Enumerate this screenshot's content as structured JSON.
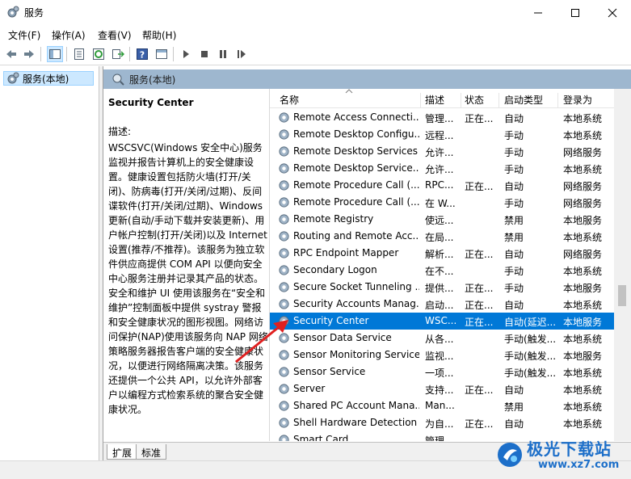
{
  "window": {
    "title": "服务"
  },
  "menu": [
    "文件(F)",
    "操作(A)",
    "查看(V)",
    "帮助(H)"
  ],
  "tree": {
    "root_label": "服务(本地)"
  },
  "panel": {
    "header": "服务(本地)"
  },
  "description": {
    "service_title": "Security Center",
    "label": "描述:",
    "text": "WSCSVC(Windows 安全中心)服务监视并报告计算机上的安全健康设置。健康设置包括防火墙(打开/关闭)、防病毒(打开/关闭/过期)、反间谍软件(打开/关闭/过期)、Windows 更新(自动/手动下载并安装更新)、用户帐户控制(打开/关闭)以及 Internet 设置(推荐/不推荐)。该服务为独立软件供应商提供 COM API 以便向安全中心服务注册并记录其产品的状态。安全和维护 UI 使用该服务在“安全和维护”控制面板中提供 systray 警报和安全健康状况的图形视图。网络访问保护(NAP)使用该服务向 NAP 网络策略服务器报告客户端的安全健康状况，以便进行网络隔离决策。该服务还提供一个公共 API，以允许外部客户以编程方式检索系统的聚合安全健康状况。"
  },
  "columns": {
    "name": "名称",
    "desc": "描述",
    "status": "状态",
    "startup": "启动类型",
    "logon": "登录为"
  },
  "rows": [
    {
      "name": "Remote Access Connecti...",
      "desc": "管理...",
      "status": "正在...",
      "startup": "自动",
      "logon": "本地系统"
    },
    {
      "name": "Remote Desktop Configu...",
      "desc": "远程...",
      "status": "",
      "startup": "手动",
      "logon": "本地系统"
    },
    {
      "name": "Remote Desktop Services",
      "desc": "允许...",
      "status": "",
      "startup": "手动",
      "logon": "网络服务"
    },
    {
      "name": "Remote Desktop Service...",
      "desc": "允许...",
      "status": "",
      "startup": "手动",
      "logon": "本地系统"
    },
    {
      "name": "Remote Procedure Call (...",
      "desc": "RPC...",
      "status": "正在...",
      "startup": "自动",
      "logon": "网络服务"
    },
    {
      "name": "Remote Procedure Call (...",
      "desc": "在 W...",
      "status": "",
      "startup": "手动",
      "logon": "网络服务"
    },
    {
      "name": "Remote Registry",
      "desc": "使远...",
      "status": "",
      "startup": "禁用",
      "logon": "本地服务"
    },
    {
      "name": "Routing and Remote Acc...",
      "desc": "在局...",
      "status": "",
      "startup": "禁用",
      "logon": "本地系统"
    },
    {
      "name": "RPC Endpoint Mapper",
      "desc": "解析...",
      "status": "正在...",
      "startup": "自动",
      "logon": "网络服务"
    },
    {
      "name": "Secondary Logon",
      "desc": "在不...",
      "status": "",
      "startup": "手动",
      "logon": "本地系统"
    },
    {
      "name": "Secure Socket Tunneling ...",
      "desc": "提供...",
      "status": "正在...",
      "startup": "手动",
      "logon": "本地服务"
    },
    {
      "name": "Security Accounts Manag...",
      "desc": "启动...",
      "status": "正在...",
      "startup": "自动",
      "logon": "本地系统"
    },
    {
      "name": "Security Center",
      "desc": "WSC...",
      "status": "正在...",
      "startup": "自动(延迟...",
      "logon": "本地服务"
    },
    {
      "name": "Sensor Data Service",
      "desc": "从各...",
      "status": "",
      "startup": "手动(触发...",
      "logon": "本地系统"
    },
    {
      "name": "Sensor Monitoring Service",
      "desc": "监视...",
      "status": "",
      "startup": "手动(触发...",
      "logon": "本地服务"
    },
    {
      "name": "Sensor Service",
      "desc": "一项...",
      "status": "",
      "startup": "手动(触发...",
      "logon": "本地系统"
    },
    {
      "name": "Server",
      "desc": "支持...",
      "status": "正在...",
      "startup": "自动",
      "logon": "本地系统"
    },
    {
      "name": "Shared PC Account Mana...",
      "desc": "Man...",
      "status": "",
      "startup": "禁用",
      "logon": "本地系统"
    },
    {
      "name": "Shell Hardware Detection",
      "desc": "为自...",
      "status": "正在...",
      "startup": "自动",
      "logon": "本地系统"
    },
    {
      "name": "Smart Card",
      "desc": "管理...",
      "status": "",
      "startup": "",
      "logon": ""
    }
  ],
  "selected_row": 12,
  "tabs": [
    "扩展",
    "标准"
  ],
  "watermark": {
    "line1": "极光下载站",
    "line2": "www.xz7.com"
  },
  "colors": {
    "selection": "#0078d7",
    "panel_header": "#9eb7cf",
    "annotation_arrow": "#e02020"
  }
}
